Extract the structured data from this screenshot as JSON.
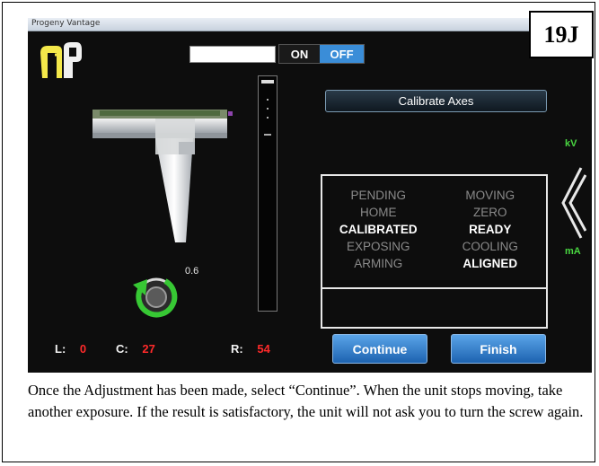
{
  "badge": "19J",
  "window": {
    "title": "Progeny Vantage"
  },
  "toggle": {
    "on": "ON",
    "off": "OFF",
    "selected": "OFF"
  },
  "calibrate_button": "Calibrate Axes",
  "status": {
    "items": [
      {
        "label": "PENDING",
        "active": false
      },
      {
        "label": "MOVING",
        "active": false
      },
      {
        "label": "HOME",
        "active": false
      },
      {
        "label": "ZERO",
        "active": false
      },
      {
        "label": "CALIBRATED",
        "active": true
      },
      {
        "label": "READY",
        "active": true
      },
      {
        "label": "EXPOSING",
        "active": false
      },
      {
        "label": "COOLING",
        "active": false
      },
      {
        "label": "ARMING",
        "active": false
      },
      {
        "label": "ALIGNED",
        "active": true
      }
    ]
  },
  "indicators": {
    "kv": "kV",
    "ma": "mA"
  },
  "screw_value": "0.6",
  "readouts": {
    "l_label": "L:",
    "l_value": "0",
    "c_label": "C:",
    "c_value": "27",
    "r_label": "R:",
    "r_value": "54"
  },
  "buttons": {
    "continue": "Continue",
    "finish": "Finish"
  },
  "caption": "Once the Adjustment has been made, select “Continue”. When the unit stops moving, take another exposure. If the result is satisfactory, the unit will not ask you to turn the screw again.",
  "colors": {
    "accent_blue": "#3a8dd8",
    "status_green": "#49d641",
    "value_red": "#ff2a2a",
    "logo_yellow": "#f4e84a"
  }
}
